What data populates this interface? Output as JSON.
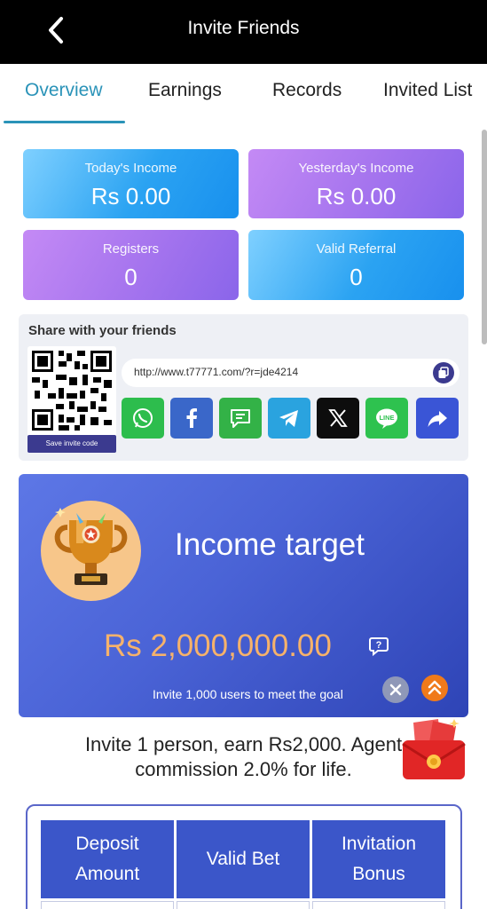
{
  "header": {
    "title": "Invite Friends",
    "back_icon": "chevron-left-icon"
  },
  "tabs": [
    {
      "label": "Overview",
      "active": true
    },
    {
      "label": "Earnings",
      "active": false
    },
    {
      "label": "Records",
      "active": false
    },
    {
      "label": "Invited List",
      "active": false
    }
  ],
  "stats": {
    "today_income": {
      "label": "Today's Income",
      "value": "Rs  0.00"
    },
    "yesterday_income": {
      "label": "Yesterday's Income",
      "value": "Rs  0.00"
    },
    "registers": {
      "label": "Registers",
      "value": "0"
    },
    "valid_referral": {
      "label": "Valid Referral",
      "value": "0"
    }
  },
  "share": {
    "title": "Share with your friends",
    "save_code_label": "Save invite code",
    "link": "http://www.t77771.com/?r=jde4214",
    "social": [
      "whatsapp-icon",
      "facebook-icon",
      "sms-icon",
      "telegram-icon",
      "x-icon",
      "line-icon",
      "share-icon"
    ]
  },
  "income_target": {
    "title": "Income target",
    "amount": "Rs  2,000,000.00",
    "subtitle": "Invite 1,000 users to meet the goal"
  },
  "invite": {
    "line1": "Invite 1 person, earn Rs2,000. Agent",
    "line2": "commission 2.0% for life."
  },
  "table": {
    "headers": [
      {
        "line1": "Deposit",
        "line2": "Amount"
      },
      {
        "line1": "Valid Bet",
        "line2": ""
      },
      {
        "line1": "Invitation",
        "line2": "Bonus"
      }
    ]
  },
  "colors": {
    "accent": "#2a93b8",
    "header_bg": "#000000",
    "banner": "#4a63d6",
    "amount": "#f6b26b"
  }
}
